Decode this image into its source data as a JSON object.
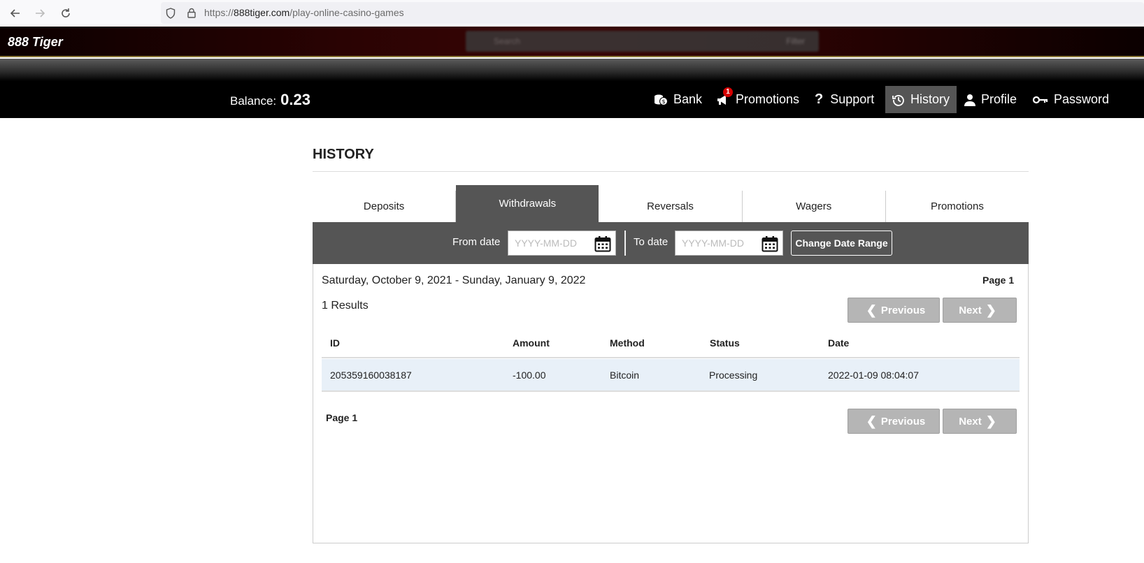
{
  "browser": {
    "url_prefix": "https://",
    "url_host": "888tiger.com",
    "url_path": "/play-online-casino-games"
  },
  "site": {
    "logo": "888 Tiger",
    "search_placeholder": "Search",
    "filter_label": "Filter"
  },
  "account": {
    "balance_label": "Balance:",
    "balance_value": "0.23"
  },
  "nav": {
    "bank": "Bank",
    "promotions": "Promotions",
    "promotions_badge": "1",
    "support": "Support",
    "history": "History",
    "profile": "Profile",
    "password": "Password"
  },
  "history": {
    "title": "HISTORY",
    "tabs": [
      "Deposits",
      "Withdrawals",
      "Reversals",
      "Wagers",
      "Promotions"
    ],
    "active_tab": "Withdrawals",
    "from_label": "From date",
    "to_label": "To date",
    "date_placeholder": "YYYY-MM-DD",
    "change_button": "Change Date Range",
    "date_range": "Saturday, October 9, 2021 - Sunday, January 9, 2022",
    "results": "1 Results",
    "page_top": "Page 1",
    "page_bottom": "Page 1",
    "previous": "Previous",
    "next": "Next",
    "columns": [
      "ID",
      "Amount",
      "Method",
      "Status",
      "Date"
    ],
    "rows": [
      [
        "205359160038187",
        "-100.00",
        "Bitcoin",
        "Processing",
        "2022-01-09 08:04:07"
      ]
    ]
  },
  "colors": {
    "header_bg": "#000000",
    "active_nav": "#555555",
    "filter_bar": "#555555",
    "row_highlight": "#e8f0f8",
    "badge": "#d40000"
  }
}
